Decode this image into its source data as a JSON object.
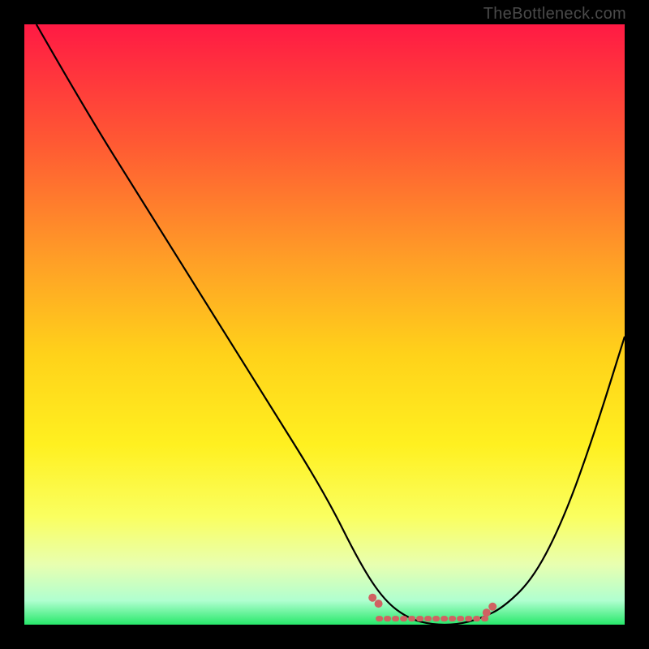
{
  "watermark": "TheBottleneck.com",
  "chart_data": {
    "type": "line",
    "title": "",
    "xlabel": "",
    "ylabel": "",
    "xlim": [
      0,
      100
    ],
    "ylim": [
      0,
      100
    ],
    "background_gradient": {
      "stops": [
        {
          "offset": 0,
          "color": "#ff1a44"
        },
        {
          "offset": 20,
          "color": "#ff5a33"
        },
        {
          "offset": 40,
          "color": "#ffa126"
        },
        {
          "offset": 55,
          "color": "#ffd21a"
        },
        {
          "offset": 70,
          "color": "#fff020"
        },
        {
          "offset": 82,
          "color": "#faff60"
        },
        {
          "offset": 90,
          "color": "#e8ffb0"
        },
        {
          "offset": 96,
          "color": "#b0ffd0"
        },
        {
          "offset": 100,
          "color": "#27e86a"
        }
      ]
    },
    "series": [
      {
        "name": "bottleneck-curve",
        "x": [
          2,
          10,
          20,
          30,
          40,
          50,
          56,
          60,
          64,
          68,
          72,
          76,
          80,
          85,
          90,
          95,
          100
        ],
        "y": [
          100,
          86,
          70,
          54,
          38,
          22,
          10,
          4,
          1,
          0,
          0,
          1,
          3,
          8,
          18,
          32,
          48
        ]
      }
    ],
    "markers": {
      "name": "bottleneck-zone-markers",
      "color": "#d06262",
      "points": [
        {
          "x": 58,
          "y": 4.5
        },
        {
          "x": 59,
          "y": 3.5
        },
        {
          "x": 77,
          "y": 2.0
        },
        {
          "x": 78,
          "y": 3.0
        }
      ],
      "band": {
        "x_start": 59,
        "x_end": 77,
        "y": 1.0
      }
    }
  }
}
